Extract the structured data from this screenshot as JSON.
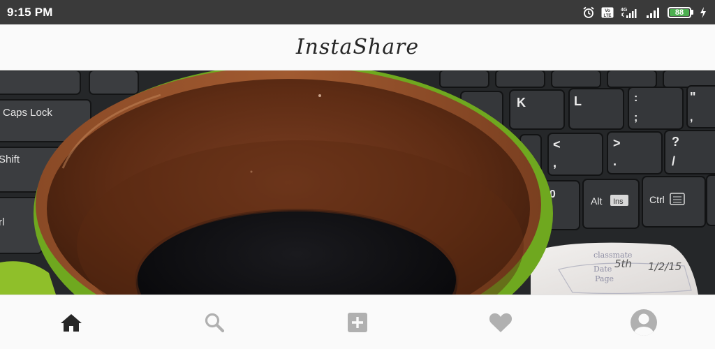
{
  "status_bar": {
    "time": "9:15 PM",
    "battery_level": "88",
    "icons": [
      "alarm-icon",
      "volte-icon",
      "signal-4g-icon",
      "signal-icon",
      "battery-icon",
      "charging-icon"
    ],
    "volte_label": "Vo LTE",
    "network_label": "4G",
    "battery_color": "#4caf50"
  },
  "app_bar": {
    "title": "InstaShare"
  },
  "photo": {
    "keyboard_keys": [
      "Caps Lock",
      "Shift",
      "rl",
      "K",
      "L",
      ":",
      ";",
      "\"",
      "<",
      ",",
      ">",
      ".",
      "?",
      "/",
      "00",
      "Alt",
      "Ins",
      "Ctrl"
    ],
    "notebook_text": [
      "classmate",
      "Date",
      "Page",
      "5th",
      "1/2/15"
    ]
  },
  "bottom_nav": {
    "items": [
      {
        "name": "home",
        "icon": "home-icon",
        "active": true
      },
      {
        "name": "search",
        "icon": "search-icon",
        "active": false
      },
      {
        "name": "add-post",
        "icon": "add-icon",
        "active": false
      },
      {
        "name": "activity",
        "icon": "heart-icon",
        "active": false
      },
      {
        "name": "profile",
        "icon": "profile-icon",
        "active": false
      }
    ],
    "active_color": "#262626",
    "inactive_color": "#b0b0b0"
  }
}
